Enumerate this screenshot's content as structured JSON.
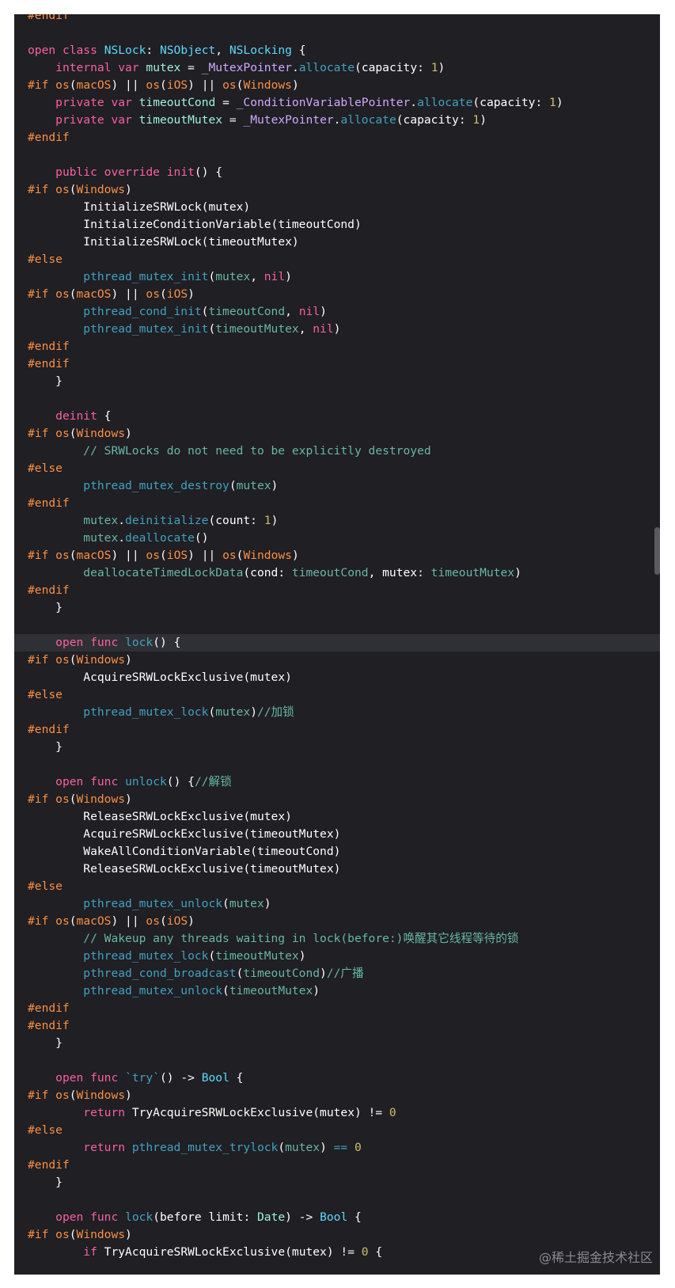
{
  "editor": {
    "theme_colors": {
      "background": "#1f1f24",
      "keyword": "#fc5fa3",
      "type": "#5dd8ff",
      "preprocessor": "#fd8f3f",
      "comment": "#6c7986",
      "number": "#d0bf69",
      "function": "#67b7a4"
    },
    "current_line_index": 36,
    "lines": [
      [
        [
          "pp",
          "#endif"
        ]
      ],
      [],
      [
        [
          "k",
          "open"
        ],
        [
          "pl",
          " "
        ],
        [
          "k",
          "class"
        ],
        [
          "pl",
          " "
        ],
        [
          "ty",
          "NSLock"
        ],
        [
          "pl",
          ": "
        ],
        [
          "ty",
          "NSObject"
        ],
        [
          "pl",
          ", "
        ],
        [
          "ty",
          "NSLocking"
        ],
        [
          "pl",
          " {"
        ]
      ],
      [
        [
          "pl",
          "    "
        ],
        [
          "k",
          "internal"
        ],
        [
          "pl",
          " "
        ],
        [
          "k",
          "var"
        ],
        [
          "pl",
          " "
        ],
        [
          "rd",
          "mutex"
        ],
        [
          "pl",
          " = "
        ],
        [
          "cl",
          "_MutexPointer"
        ],
        [
          "pl",
          "."
        ],
        [
          "xf",
          "allocate"
        ],
        [
          "pl",
          "(capacity: "
        ],
        [
          "nm",
          "1"
        ],
        [
          "pl",
          ")"
        ]
      ],
      [
        [
          "pp",
          "#if"
        ],
        [
          "pl",
          " "
        ],
        [
          "pp",
          "os"
        ],
        [
          "pl",
          "("
        ],
        [
          "pp",
          "macOS"
        ],
        [
          "pl",
          ") || "
        ],
        [
          "pp",
          "os"
        ],
        [
          "pl",
          "("
        ],
        [
          "pp",
          "iOS"
        ],
        [
          "pl",
          ") || "
        ],
        [
          "pp",
          "os"
        ],
        [
          "pl",
          "("
        ],
        [
          "pp",
          "Windows"
        ],
        [
          "pl",
          ")"
        ]
      ],
      [
        [
          "pl",
          "    "
        ],
        [
          "k",
          "private"
        ],
        [
          "pl",
          " "
        ],
        [
          "k",
          "var"
        ],
        [
          "pl",
          " "
        ],
        [
          "rd",
          "timeoutCond"
        ],
        [
          "pl",
          " = "
        ],
        [
          "cl",
          "_ConditionVariablePointer"
        ],
        [
          "pl",
          "."
        ],
        [
          "xf",
          "allocate"
        ],
        [
          "pl",
          "(capacity: "
        ],
        [
          "nm",
          "1"
        ],
        [
          "pl",
          ")"
        ]
      ],
      [
        [
          "pl",
          "    "
        ],
        [
          "k",
          "private"
        ],
        [
          "pl",
          " "
        ],
        [
          "k",
          "var"
        ],
        [
          "pl",
          " "
        ],
        [
          "rd",
          "timeoutMutex"
        ],
        [
          "pl",
          " = "
        ],
        [
          "cl",
          "_MutexPointer"
        ],
        [
          "pl",
          "."
        ],
        [
          "xf",
          "allocate"
        ],
        [
          "pl",
          "(capacity: "
        ],
        [
          "nm",
          "1"
        ],
        [
          "pl",
          ")"
        ]
      ],
      [
        [
          "pp",
          "#endif"
        ]
      ],
      [],
      [
        [
          "pl",
          "    "
        ],
        [
          "k",
          "public"
        ],
        [
          "pl",
          " "
        ],
        [
          "k",
          "override"
        ],
        [
          "pl",
          " "
        ],
        [
          "k",
          "init"
        ],
        [
          "pl",
          "() {"
        ]
      ],
      [
        [
          "pp",
          "#if"
        ],
        [
          "pl",
          " "
        ],
        [
          "pp",
          "os"
        ],
        [
          "pl",
          "("
        ],
        [
          "pp",
          "Windows"
        ],
        [
          "pl",
          ")"
        ]
      ],
      [
        [
          "pl",
          "        "
        ],
        [
          "wh",
          "InitializeSRWLock"
        ],
        [
          "pl",
          "(mutex)"
        ]
      ],
      [
        [
          "pl",
          "        "
        ],
        [
          "wh",
          "InitializeConditionVariable"
        ],
        [
          "pl",
          "(timeoutCond)"
        ]
      ],
      [
        [
          "pl",
          "        "
        ],
        [
          "wh",
          "InitializeSRWLock"
        ],
        [
          "pl",
          "(timeoutMutex)"
        ]
      ],
      [
        [
          "pp",
          "#else"
        ]
      ],
      [
        [
          "pl",
          "        "
        ],
        [
          "xf",
          "pthread_mutex_init"
        ],
        [
          "pl",
          "("
        ],
        [
          "fn",
          "mutex"
        ],
        [
          "pl",
          ", "
        ],
        [
          "k",
          "nil"
        ],
        [
          "pl",
          ")"
        ]
      ],
      [
        [
          "pp",
          "#if"
        ],
        [
          "pl",
          " "
        ],
        [
          "pp",
          "os"
        ],
        [
          "pl",
          "("
        ],
        [
          "pp",
          "macOS"
        ],
        [
          "pl",
          ") || "
        ],
        [
          "pp",
          "os"
        ],
        [
          "pl",
          "("
        ],
        [
          "pp",
          "iOS"
        ],
        [
          "pl",
          ")"
        ]
      ],
      [
        [
          "pl",
          "        "
        ],
        [
          "xf",
          "pthread_cond_init"
        ],
        [
          "pl",
          "("
        ],
        [
          "fn",
          "timeoutCond"
        ],
        [
          "pl",
          ", "
        ],
        [
          "k",
          "nil"
        ],
        [
          "pl",
          ")"
        ]
      ],
      [
        [
          "pl",
          "        "
        ],
        [
          "xf",
          "pthread_mutex_init"
        ],
        [
          "pl",
          "("
        ],
        [
          "fn",
          "timeoutMutex"
        ],
        [
          "pl",
          ", "
        ],
        [
          "k",
          "nil"
        ],
        [
          "pl",
          ")"
        ]
      ],
      [
        [
          "pp",
          "#endif"
        ]
      ],
      [
        [
          "pp",
          "#endif"
        ]
      ],
      [
        [
          "pl",
          "    }"
        ]
      ],
      [],
      [
        [
          "pl",
          "    "
        ],
        [
          "k",
          "deinit"
        ],
        [
          "pl",
          " {"
        ]
      ],
      [
        [
          "pp",
          "#if"
        ],
        [
          "pl",
          " "
        ],
        [
          "pp",
          "os"
        ],
        [
          "pl",
          "("
        ],
        [
          "pp",
          "Windows"
        ],
        [
          "pl",
          ")"
        ]
      ],
      [
        [
          "pl",
          "        "
        ],
        [
          "gc",
          "// SRWLocks do not need to be explicitly destroyed"
        ]
      ],
      [
        [
          "pp",
          "#else"
        ]
      ],
      [
        [
          "pl",
          "        "
        ],
        [
          "xf",
          "pthread_mutex_destroy"
        ],
        [
          "pl",
          "("
        ],
        [
          "fn",
          "mutex"
        ],
        [
          "pl",
          ")"
        ]
      ],
      [
        [
          "pp",
          "#endif"
        ]
      ],
      [
        [
          "pl",
          "        "
        ],
        [
          "fn",
          "mutex"
        ],
        [
          "pl",
          "."
        ],
        [
          "xf",
          "deinitialize"
        ],
        [
          "pl",
          "(count: "
        ],
        [
          "nm",
          "1"
        ],
        [
          "pl",
          ")"
        ]
      ],
      [
        [
          "pl",
          "        "
        ],
        [
          "fn",
          "mutex"
        ],
        [
          "pl",
          "."
        ],
        [
          "xf",
          "deallocate"
        ],
        [
          "pl",
          "()"
        ]
      ],
      [
        [
          "pp",
          "#if"
        ],
        [
          "pl",
          " "
        ],
        [
          "pp",
          "os"
        ],
        [
          "pl",
          "("
        ],
        [
          "pp",
          "macOS"
        ],
        [
          "pl",
          ") || "
        ],
        [
          "pp",
          "os"
        ],
        [
          "pl",
          "("
        ],
        [
          "pp",
          "iOS"
        ],
        [
          "pl",
          ") || "
        ],
        [
          "pp",
          "os"
        ],
        [
          "pl",
          "("
        ],
        [
          "pp",
          "Windows"
        ],
        [
          "pl",
          ")"
        ]
      ],
      [
        [
          "pl",
          "        "
        ],
        [
          "fn",
          "deallocateTimedLockData"
        ],
        [
          "pl",
          "(cond: "
        ],
        [
          "fn",
          "timeoutCond"
        ],
        [
          "pl",
          ", mutex: "
        ],
        [
          "fn",
          "timeoutMutex"
        ],
        [
          "pl",
          ")"
        ]
      ],
      [
        [
          "pp",
          "#endif"
        ]
      ],
      [
        [
          "pl",
          "    }"
        ]
      ],
      [],
      [
        [
          "pl",
          "    "
        ],
        [
          "k",
          "open"
        ],
        [
          "pl",
          " "
        ],
        [
          "k",
          "func"
        ],
        [
          "pl",
          " "
        ],
        [
          "xf",
          "lock"
        ],
        [
          "pl",
          "() {"
        ]
      ],
      [
        [
          "pp",
          "#if"
        ],
        [
          "pl",
          " "
        ],
        [
          "pp",
          "os"
        ],
        [
          "pl",
          "("
        ],
        [
          "pp",
          "Windows"
        ],
        [
          "pl",
          ")"
        ]
      ],
      [
        [
          "pl",
          "        "
        ],
        [
          "wh",
          "AcquireSRWLockExclusive"
        ],
        [
          "pl",
          "(mutex)"
        ]
      ],
      [
        [
          "pp",
          "#else"
        ]
      ],
      [
        [
          "pl",
          "        "
        ],
        [
          "xf",
          "pthread_mutex_lock"
        ],
        [
          "pl",
          "("
        ],
        [
          "fn",
          "mutex"
        ],
        [
          "pl",
          ")"
        ],
        [
          "gc",
          "//加锁"
        ]
      ],
      [
        [
          "pp",
          "#endif"
        ]
      ],
      [
        [
          "pl",
          "    }"
        ]
      ],
      [],
      [
        [
          "pl",
          "    "
        ],
        [
          "k",
          "open"
        ],
        [
          "pl",
          " "
        ],
        [
          "k",
          "func"
        ],
        [
          "pl",
          " "
        ],
        [
          "xf",
          "unlock"
        ],
        [
          "pl",
          "() {"
        ],
        [
          "gc",
          "//解锁"
        ]
      ],
      [
        [
          "pp",
          "#if"
        ],
        [
          "pl",
          " "
        ],
        [
          "pp",
          "os"
        ],
        [
          "pl",
          "("
        ],
        [
          "pp",
          "Windows"
        ],
        [
          "pl",
          ")"
        ]
      ],
      [
        [
          "pl",
          "        "
        ],
        [
          "wh",
          "ReleaseSRWLockExclusive"
        ],
        [
          "pl",
          "(mutex)"
        ]
      ],
      [
        [
          "pl",
          "        "
        ],
        [
          "wh",
          "AcquireSRWLockExclusive"
        ],
        [
          "pl",
          "(timeoutMutex)"
        ]
      ],
      [
        [
          "pl",
          "        "
        ],
        [
          "wh",
          "WakeAllConditionVariable"
        ],
        [
          "pl",
          "(timeoutCond)"
        ]
      ],
      [
        [
          "pl",
          "        "
        ],
        [
          "wh",
          "ReleaseSRWLockExclusive"
        ],
        [
          "pl",
          "(timeoutMutex)"
        ]
      ],
      [
        [
          "pp",
          "#else"
        ]
      ],
      [
        [
          "pl",
          "        "
        ],
        [
          "xf",
          "pthread_mutex_unlock"
        ],
        [
          "pl",
          "("
        ],
        [
          "fn",
          "mutex"
        ],
        [
          "pl",
          ")"
        ]
      ],
      [
        [
          "pp",
          "#if"
        ],
        [
          "pl",
          " "
        ],
        [
          "pp",
          "os"
        ],
        [
          "pl",
          "("
        ],
        [
          "pp",
          "macOS"
        ],
        [
          "pl",
          ") || "
        ],
        [
          "pp",
          "os"
        ],
        [
          "pl",
          "("
        ],
        [
          "pp",
          "iOS"
        ],
        [
          "pl",
          ")"
        ]
      ],
      [
        [
          "pl",
          "        "
        ],
        [
          "gc",
          "// Wakeup any threads waiting in lock(before:)唤醒其它线程等待的锁"
        ]
      ],
      [
        [
          "pl",
          "        "
        ],
        [
          "xf",
          "pthread_mutex_lock"
        ],
        [
          "pl",
          "("
        ],
        [
          "fn",
          "timeoutMutex"
        ],
        [
          "pl",
          ")"
        ]
      ],
      [
        [
          "pl",
          "        "
        ],
        [
          "xf",
          "pthread_cond_broadcast"
        ],
        [
          "pl",
          "("
        ],
        [
          "fn",
          "timeoutCond"
        ],
        [
          "pl",
          ")"
        ],
        [
          "gc",
          "//广播"
        ]
      ],
      [
        [
          "pl",
          "        "
        ],
        [
          "xf",
          "pthread_mutex_unlock"
        ],
        [
          "pl",
          "("
        ],
        [
          "fn",
          "timeoutMutex"
        ],
        [
          "pl",
          ")"
        ]
      ],
      [
        [
          "pp",
          "#endif"
        ]
      ],
      [
        [
          "pp",
          "#endif"
        ]
      ],
      [
        [
          "pl",
          "    }"
        ]
      ],
      [],
      [
        [
          "pl",
          "    "
        ],
        [
          "k",
          "open"
        ],
        [
          "pl",
          " "
        ],
        [
          "k",
          "func"
        ],
        [
          "pl",
          " "
        ],
        [
          "xf",
          "`try`"
        ],
        [
          "pl",
          "() -> "
        ],
        [
          "ty",
          "Bool"
        ],
        [
          "pl",
          " {"
        ]
      ],
      [
        [
          "pp",
          "#if"
        ],
        [
          "pl",
          " "
        ],
        [
          "pp",
          "os"
        ],
        [
          "pl",
          "("
        ],
        [
          "pp",
          "Windows"
        ],
        [
          "pl",
          ")"
        ]
      ],
      [
        [
          "pl",
          "        "
        ],
        [
          "k",
          "return"
        ],
        [
          "pl",
          " "
        ],
        [
          "wh",
          "TryAcquireSRWLockExclusive"
        ],
        [
          "pl",
          "(mutex) != "
        ],
        [
          "nm",
          "0"
        ]
      ],
      [
        [
          "pp",
          "#else"
        ]
      ],
      [
        [
          "pl",
          "        "
        ],
        [
          "k",
          "return"
        ],
        [
          "pl",
          " "
        ],
        [
          "xf",
          "pthread_mutex_trylock"
        ],
        [
          "pl",
          "("
        ],
        [
          "fn",
          "mutex"
        ],
        [
          "pl",
          ") "
        ],
        [
          "xf",
          "=="
        ],
        [
          "pl",
          " "
        ],
        [
          "nm",
          "0"
        ]
      ],
      [
        [
          "pp",
          "#endif"
        ]
      ],
      [
        [
          "pl",
          "    }"
        ]
      ],
      [],
      [
        [
          "pl",
          "    "
        ],
        [
          "k",
          "open"
        ],
        [
          "pl",
          " "
        ],
        [
          "k",
          "func"
        ],
        [
          "pl",
          " "
        ],
        [
          "xf",
          "lock"
        ],
        [
          "pl",
          "(before limit: "
        ],
        [
          "rd",
          "Date"
        ],
        [
          "pl",
          ") -> "
        ],
        [
          "ty",
          "Bool"
        ],
        [
          "pl",
          " {"
        ]
      ],
      [
        [
          "pp",
          "#if"
        ],
        [
          "pl",
          " "
        ],
        [
          "pp",
          "os"
        ],
        [
          "pl",
          "("
        ],
        [
          "pp",
          "Windows"
        ],
        [
          "pl",
          ")"
        ]
      ],
      [
        [
          "pl",
          "        "
        ],
        [
          "k",
          "if"
        ],
        [
          "pl",
          " "
        ],
        [
          "wh",
          "TryAcquireSRWLockExclusive"
        ],
        [
          "pl",
          "(mutex) != "
        ],
        [
          "nm",
          "0"
        ],
        [
          "pl",
          " {"
        ]
      ]
    ]
  },
  "watermark": {
    "text": "@稀土掘金技术社区"
  }
}
